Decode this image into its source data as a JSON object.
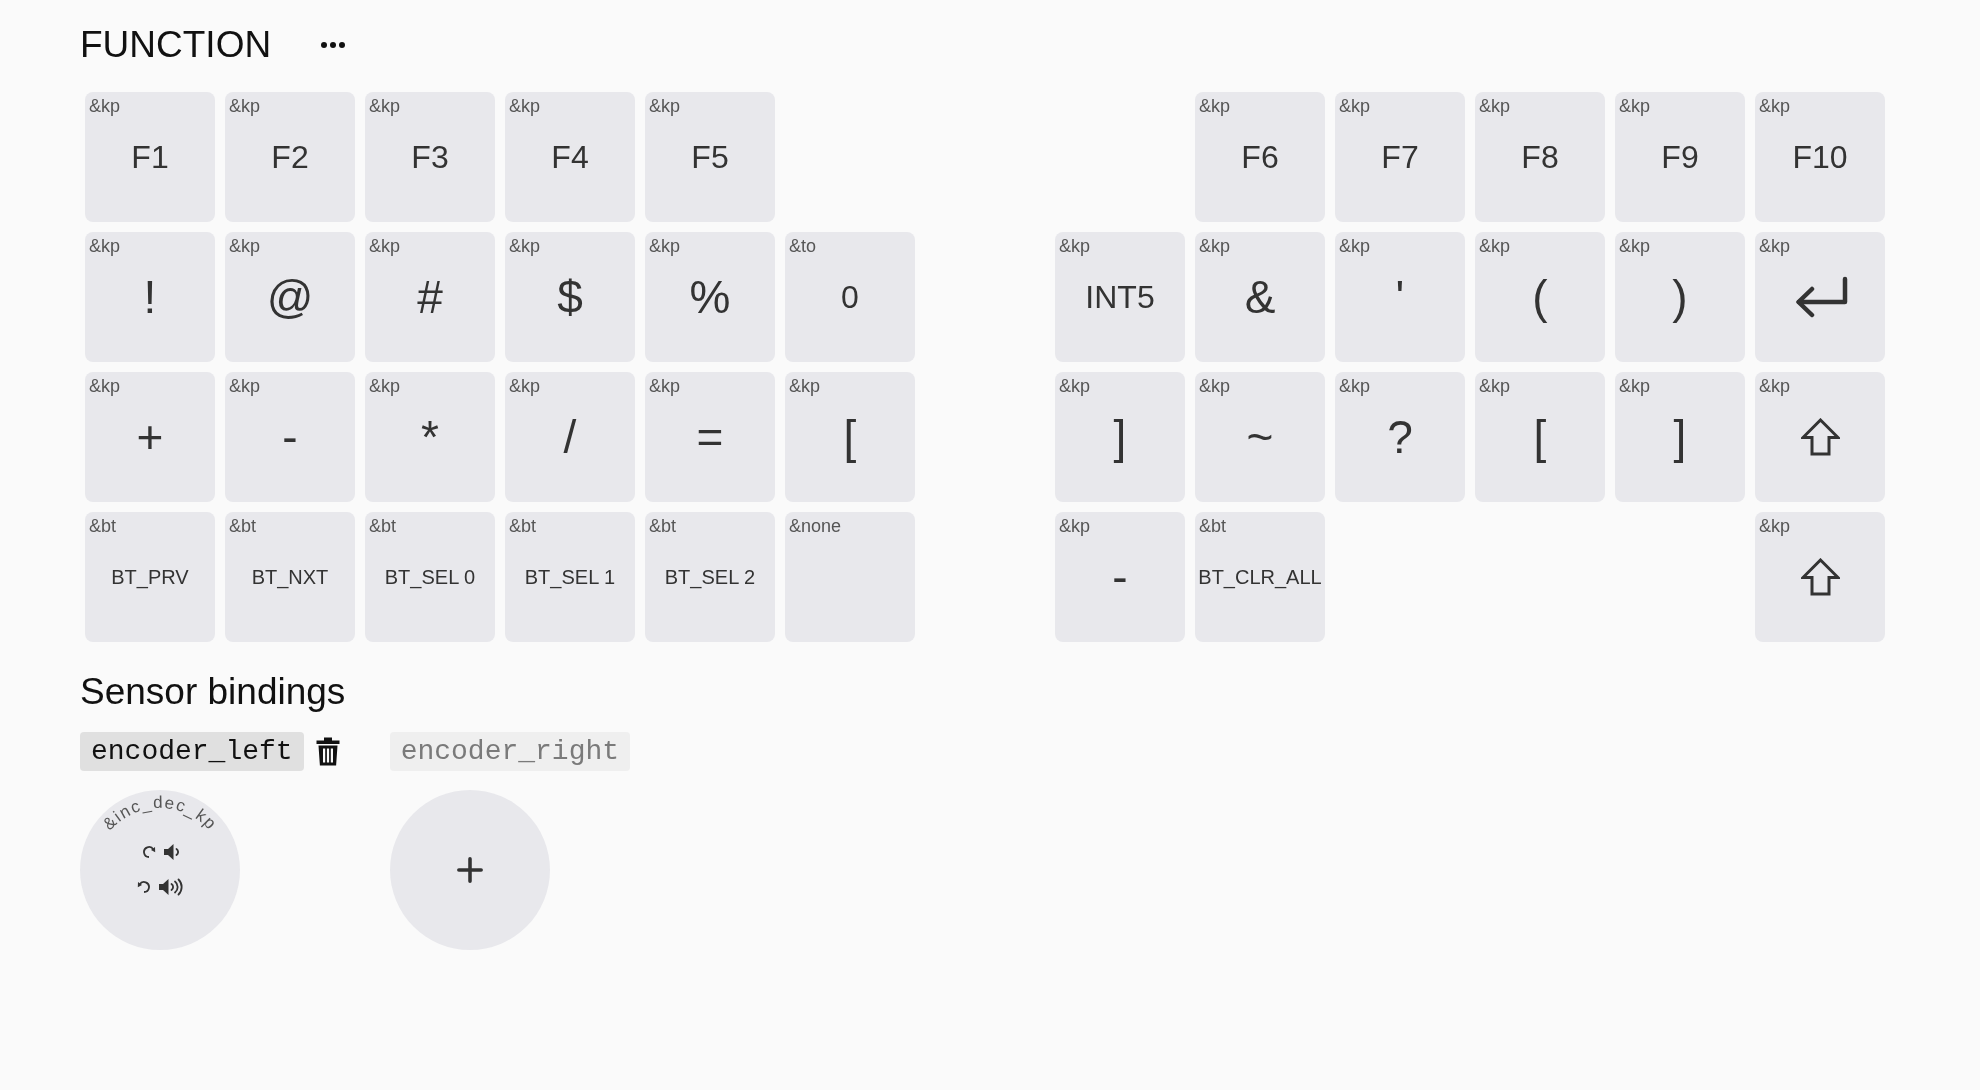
{
  "layer": {
    "name": "FUNCTION"
  },
  "keyboard": {
    "halves": [
      {
        "rows": [
          [
            {
              "kind": "text",
              "behavior": "&kp",
              "legend": "F1"
            },
            {
              "kind": "text",
              "behavior": "&kp",
              "legend": "F2"
            },
            {
              "kind": "text",
              "behavior": "&kp",
              "legend": "F3"
            },
            {
              "kind": "text",
              "behavior": "&kp",
              "legend": "F4"
            },
            {
              "kind": "text",
              "behavior": "&kp",
              "legend": "F5"
            },
            {
              "kind": "gap"
            }
          ],
          [
            {
              "kind": "symbol",
              "behavior": "&kp",
              "legend": "!"
            },
            {
              "kind": "symbol",
              "behavior": "&kp",
              "legend": "@"
            },
            {
              "kind": "symbol",
              "behavior": "&kp",
              "legend": "#"
            },
            {
              "kind": "symbol",
              "behavior": "&kp",
              "legend": "$"
            },
            {
              "kind": "symbol",
              "behavior": "&kp",
              "legend": "%"
            },
            {
              "kind": "text",
              "behavior": "&to",
              "legend": "0"
            }
          ],
          [
            {
              "kind": "symbol",
              "behavior": "&kp",
              "legend": "+"
            },
            {
              "kind": "symbol",
              "behavior": "&kp",
              "legend": "-"
            },
            {
              "kind": "symbol",
              "behavior": "&kp",
              "legend": "*"
            },
            {
              "kind": "symbol",
              "behavior": "&kp",
              "legend": "/"
            },
            {
              "kind": "symbol",
              "behavior": "&kp",
              "legend": "="
            },
            {
              "kind": "symbol",
              "behavior": "&kp",
              "legend": "["
            }
          ],
          [
            {
              "kind": "code",
              "behavior": "&bt",
              "legend": "BT_PRV"
            },
            {
              "kind": "code",
              "behavior": "&bt",
              "legend": "BT_NXT"
            },
            {
              "kind": "code",
              "behavior": "&bt",
              "legend": "BT_SEL 0"
            },
            {
              "kind": "code",
              "behavior": "&bt",
              "legend": "BT_SEL 1"
            },
            {
              "kind": "code",
              "behavior": "&bt",
              "legend": "BT_SEL 2"
            },
            {
              "kind": "text",
              "behavior": "&none"
            }
          ]
        ]
      },
      {
        "rows": [
          [
            {
              "kind": "gap"
            },
            {
              "kind": "text",
              "behavior": "&kp",
              "legend": "F6"
            },
            {
              "kind": "text",
              "behavior": "&kp",
              "legend": "F7"
            },
            {
              "kind": "text",
              "behavior": "&kp",
              "legend": "F8"
            },
            {
              "kind": "text",
              "behavior": "&kp",
              "legend": "F9"
            },
            {
              "kind": "text",
              "behavior": "&kp",
              "legend": "F10"
            }
          ],
          [
            {
              "kind": "text",
              "behavior": "&kp",
              "legend": "INT5"
            },
            {
              "kind": "symbol",
              "behavior": "&kp",
              "legend": "&"
            },
            {
              "kind": "symbol",
              "behavior": "&kp",
              "legend": "'"
            },
            {
              "kind": "symbol",
              "behavior": "&kp",
              "legend": "("
            },
            {
              "kind": "symbol",
              "behavior": "&kp",
              "legend": ")"
            },
            {
              "kind": "enter",
              "behavior": "&kp"
            }
          ],
          [
            {
              "kind": "symbol",
              "behavior": "&kp",
              "legend": "]"
            },
            {
              "kind": "symbol",
              "behavior": "&kp",
              "legend": "~"
            },
            {
              "kind": "symbol",
              "behavior": "&kp",
              "legend": "?"
            },
            {
              "kind": "symbol",
              "behavior": "&kp",
              "legend": "["
            },
            {
              "kind": "symbol",
              "behavior": "&kp",
              "legend": "]"
            },
            {
              "kind": "shift",
              "behavior": "&kp"
            }
          ],
          [
            {
              "kind": "symbol",
              "behavior": "&kp",
              "legend": "-"
            },
            {
              "kind": "code",
              "behavior": "&bt",
              "legend": "BT_CLR_ALL"
            },
            {
              "kind": "gap"
            },
            {
              "kind": "gap"
            },
            {
              "kind": "gap"
            },
            {
              "kind": "shift",
              "behavior": "&kp"
            }
          ]
        ]
      }
    ]
  },
  "sensors": {
    "title": "Sensor bindings",
    "items": [
      {
        "label": "encoder_left",
        "binding": "&inc_dec_kp"
      },
      {
        "label": "encoder_right"
      }
    ]
  }
}
